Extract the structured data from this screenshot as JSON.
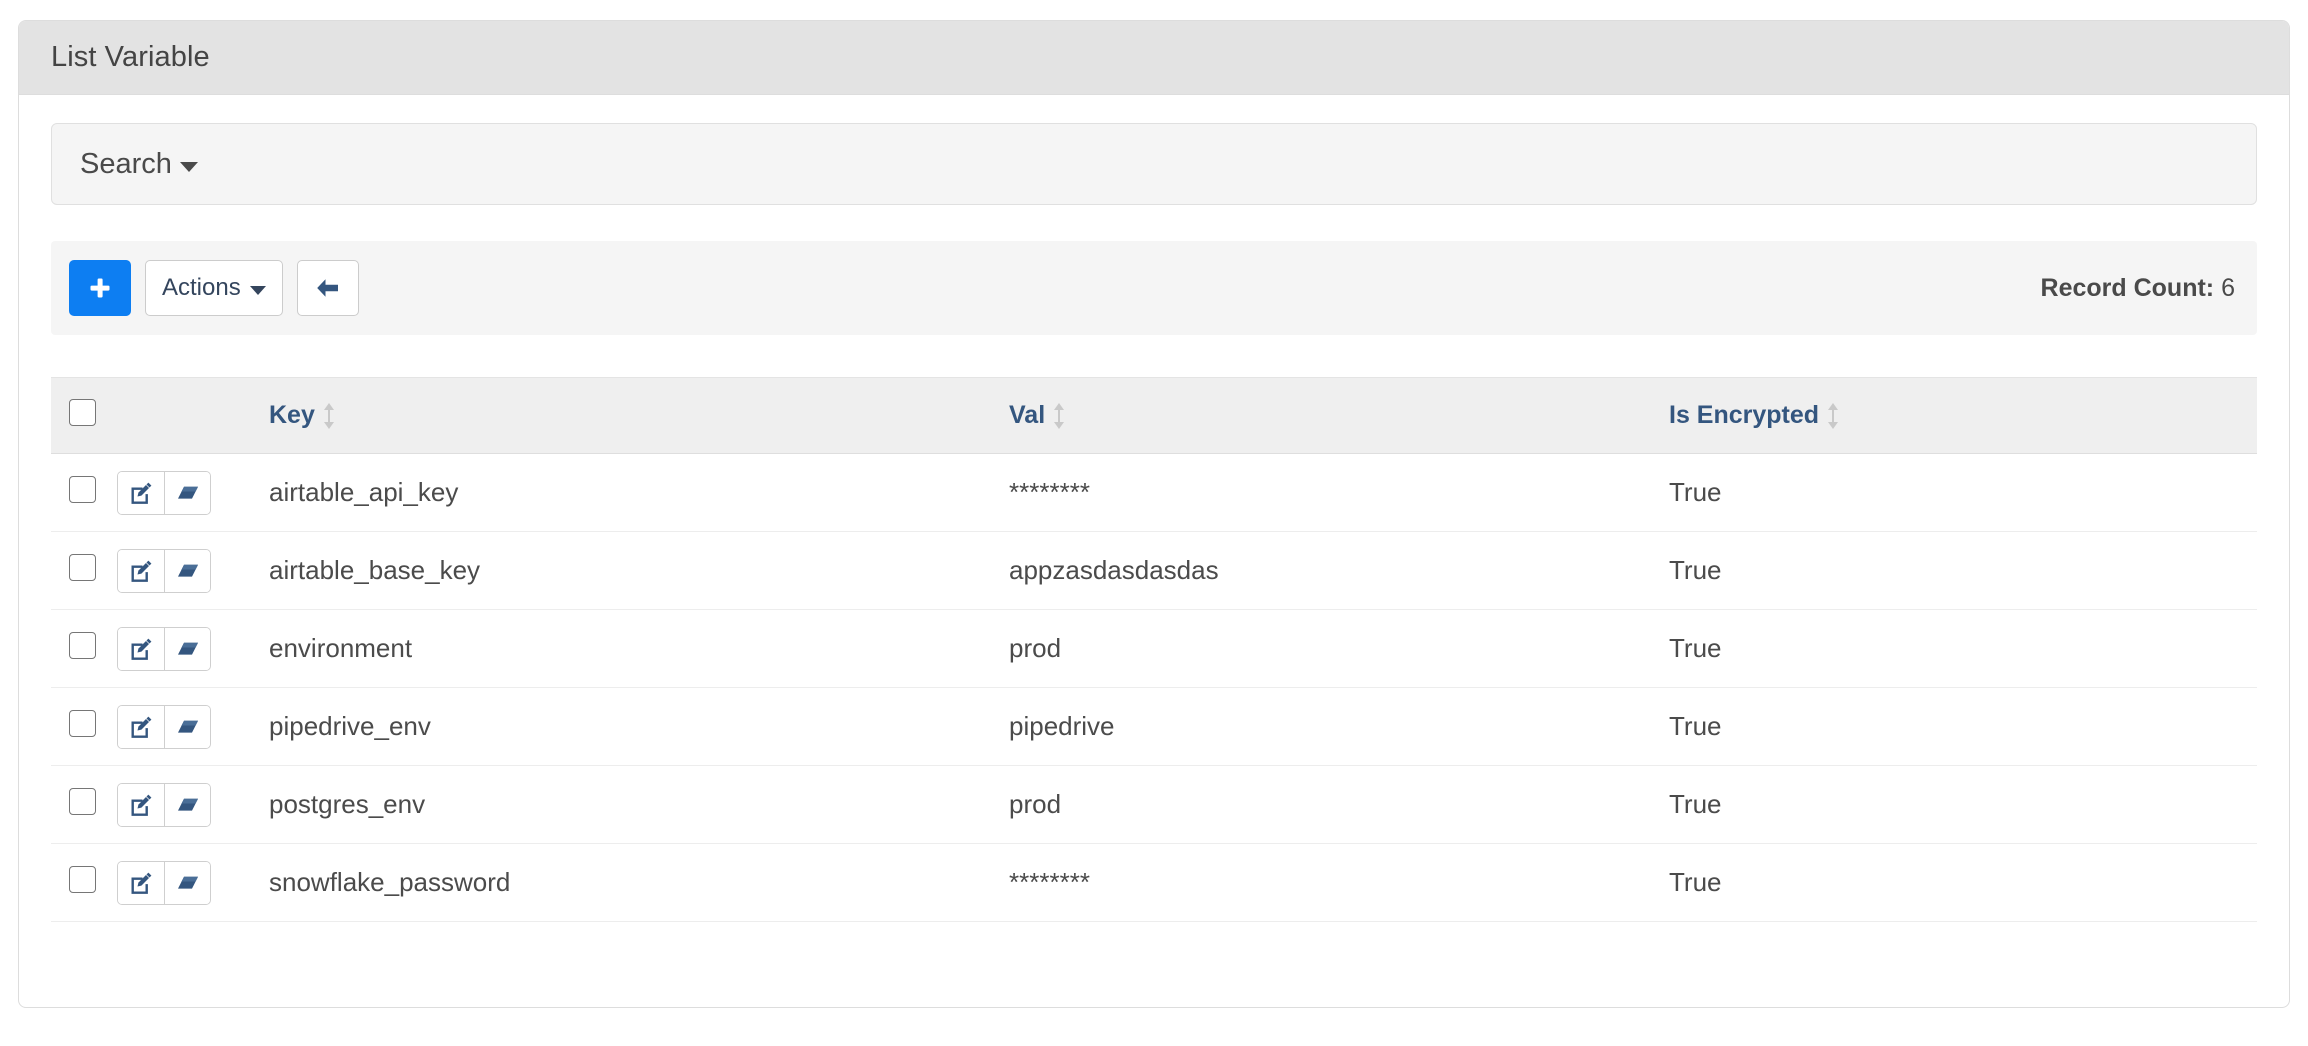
{
  "panel": {
    "title": "List Variable"
  },
  "search": {
    "label": "Search",
    "caret_icon": "caret-down-icon"
  },
  "toolbar": {
    "add_label": "+",
    "add_icon": "plus-icon",
    "actions_label": "Actions",
    "actions_caret_icon": "caret-down-icon",
    "back_icon": "arrow-left-icon",
    "record_count_label": "Record Count:",
    "record_count_value": "6"
  },
  "table": {
    "select_all_icon": "checkbox-unchecked-icon",
    "sort_icon": "sort-updown-icon",
    "columns": [
      {
        "key": "check",
        "label": ""
      },
      {
        "key": "actions",
        "label": ""
      },
      {
        "key": "key",
        "label": "Key"
      },
      {
        "key": "val",
        "label": "Val"
      },
      {
        "key": "enc",
        "label": "Is Encrypted"
      }
    ],
    "row_actions": [
      {
        "name": "edit-icon",
        "title": "Edit"
      },
      {
        "name": "eraser-icon",
        "title": "Erase"
      }
    ],
    "rows": [
      {
        "key": "airtable_api_key",
        "val": "********",
        "enc": "True"
      },
      {
        "key": "airtable_base_key",
        "val": "appzasdasdasdas",
        "enc": "True"
      },
      {
        "key": "environment",
        "val": "prod",
        "enc": "True"
      },
      {
        "key": "pipedrive_env",
        "val": "pipedrive",
        "enc": "True"
      },
      {
        "key": "postgres_env",
        "val": "prod",
        "enc": "True"
      },
      {
        "key": "snowflake_password",
        "val": "********",
        "enc": "True"
      }
    ]
  },
  "colors": {
    "primary_blue": "#0d7ef2",
    "header_link_blue": "#34567f",
    "icon_slate": "#34567f",
    "panel_heading_bg": "#e3e3e3",
    "well_bg": "#f5f5f5",
    "thead_bg": "#efefef"
  }
}
